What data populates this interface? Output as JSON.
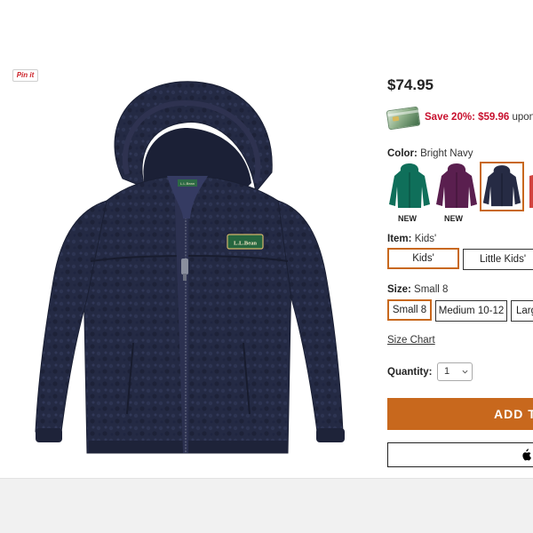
{
  "pinit": {
    "label": "Pin it"
  },
  "product": {
    "price": "$74.95",
    "promo": {
      "highlight": "Save 20%: $59.96",
      "rest": " upon"
    },
    "colors": {
      "label": "Color:",
      "selected": "Bright Navy",
      "swatches": [
        {
          "name": "green-jacket",
          "hex": "#0f6f5a",
          "badge": "NEW"
        },
        {
          "name": "plum-jacket",
          "hex": "#5a1f4f",
          "badge": "NEW"
        },
        {
          "name": "navy-jacket",
          "hex": "#262b44",
          "badge": ""
        },
        {
          "name": "red-jacket",
          "hex": "#d2443f",
          "badge": ""
        }
      ]
    },
    "item": {
      "label": "Item:",
      "selected": "Kids'",
      "options": [
        "Kids'",
        "Little Kids'"
      ]
    },
    "size": {
      "label": "Size:",
      "selected": "Small 8",
      "options": [
        "Small 8",
        "Medium 10-12",
        "Larg"
      ]
    },
    "size_chart": "Size Chart",
    "quantity": {
      "label": "Quantity:",
      "value": "1"
    },
    "add_to_bag": "ADD T",
    "accent": "#c8681d",
    "sale_color": "#c8102e"
  },
  "image": {
    "logo_text": "L.L.Bean",
    "tag_text": "L.L.Bean"
  }
}
